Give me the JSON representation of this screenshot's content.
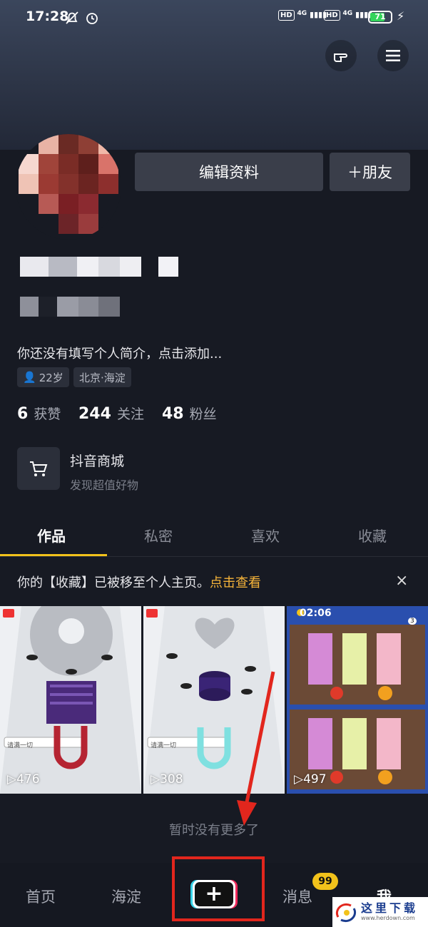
{
  "status_bar": {
    "time": "17:28",
    "net1": "HD",
    "net1_type": "4G",
    "net2": "HD",
    "net2_type": "4G",
    "battery": "71",
    "battery_level_percent": 71,
    "icons": [
      "mute-bell-icon",
      "alarm-clock-icon",
      "charging-bolt-icon"
    ]
  },
  "header": {
    "icons": [
      "pointing-hand-icon",
      "menu-icon"
    ]
  },
  "profile": {
    "edit_button": "编辑资料",
    "friend_button": "＋朋友",
    "bio": "你还没有填写个人简介，点击添加...",
    "tags": [
      "22岁",
      "北京·海淀"
    ],
    "stats": [
      {
        "value": "6",
        "label": "获赞"
      },
      {
        "value": "244",
        "label": "关注"
      },
      {
        "value": "48",
        "label": "粉丝"
      }
    ]
  },
  "shop": {
    "title": "抖音商城",
    "subtitle": "发现超值好物"
  },
  "tabs": [
    "作品",
    "私密",
    "喜欢",
    "收藏"
  ],
  "active_tab": "作品",
  "notice": {
    "text": "你的【收藏】已被移至个人主页。",
    "link": "点击查看",
    "close": "×"
  },
  "videos": [
    {
      "views": "476",
      "search_hint": "请满一切"
    },
    {
      "views": "308",
      "search_hint": "请满一切"
    },
    {
      "views": "497",
      "timer": "02:06",
      "badge": "3"
    }
  ],
  "end_text": "暂时没有更多了",
  "bottom_nav": {
    "items": [
      "首页",
      "海淀",
      "消息",
      "我"
    ],
    "plus": "+",
    "badge": "99"
  },
  "watermark": {
    "title": "这里下载",
    "subtitle": "www.herdown.com"
  },
  "colors": {
    "accent": "#f2c21b",
    "link": "#f6b43a",
    "annotation": "#e2261d",
    "background": "#171a23"
  }
}
